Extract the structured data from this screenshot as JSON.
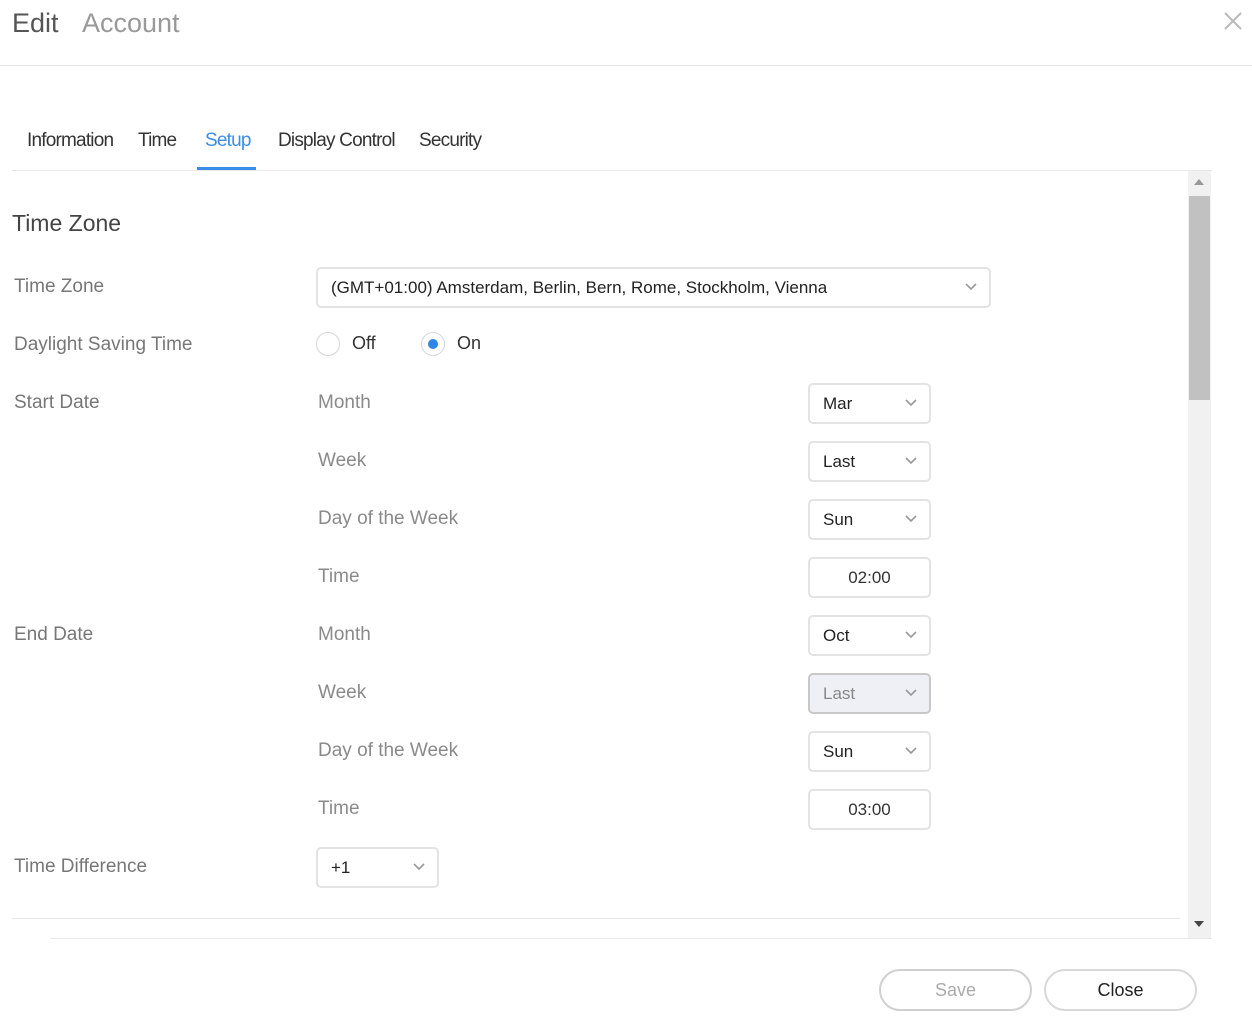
{
  "header": {
    "title": "Edit",
    "subtitle": "Account"
  },
  "tabs": [
    {
      "label": "Information",
      "active": false
    },
    {
      "label": "Time",
      "active": false
    },
    {
      "label": "Setup",
      "active": true
    },
    {
      "label": "Display Control",
      "active": false
    },
    {
      "label": "Security",
      "active": false
    }
  ],
  "section": {
    "title": "Time Zone"
  },
  "timezone": {
    "label": "Time Zone",
    "value": "(GMT+01:00) Amsterdam, Berlin, Bern, Rome, Stockholm, Vienna"
  },
  "dst": {
    "label": "Daylight Saving Time",
    "options": [
      {
        "label": "Off",
        "checked": false
      },
      {
        "label": "On",
        "checked": true
      }
    ]
  },
  "start_date": {
    "label": "Start Date",
    "month_label": "Month",
    "month": "Mar",
    "week_label": "Week",
    "week": "Last",
    "day_label": "Day of the Week",
    "day": "Sun",
    "time_label": "Time",
    "time": "02:00"
  },
  "end_date": {
    "label": "End Date",
    "month_label": "Month",
    "month": "Oct",
    "week_label": "Week",
    "week": "Last",
    "day_label": "Day of the Week",
    "day": "Sun",
    "time_label": "Time",
    "time": "03:00"
  },
  "time_difference": {
    "label": "Time Difference",
    "value": "+1"
  },
  "buttons": {
    "save": "Save",
    "close": "Close"
  },
  "colors": {
    "accent": "#3a8ee6",
    "radio_checked": "#2e86e6"
  },
  "icons": {
    "close": "close-icon",
    "dropdown": "chevron-down-icon"
  }
}
